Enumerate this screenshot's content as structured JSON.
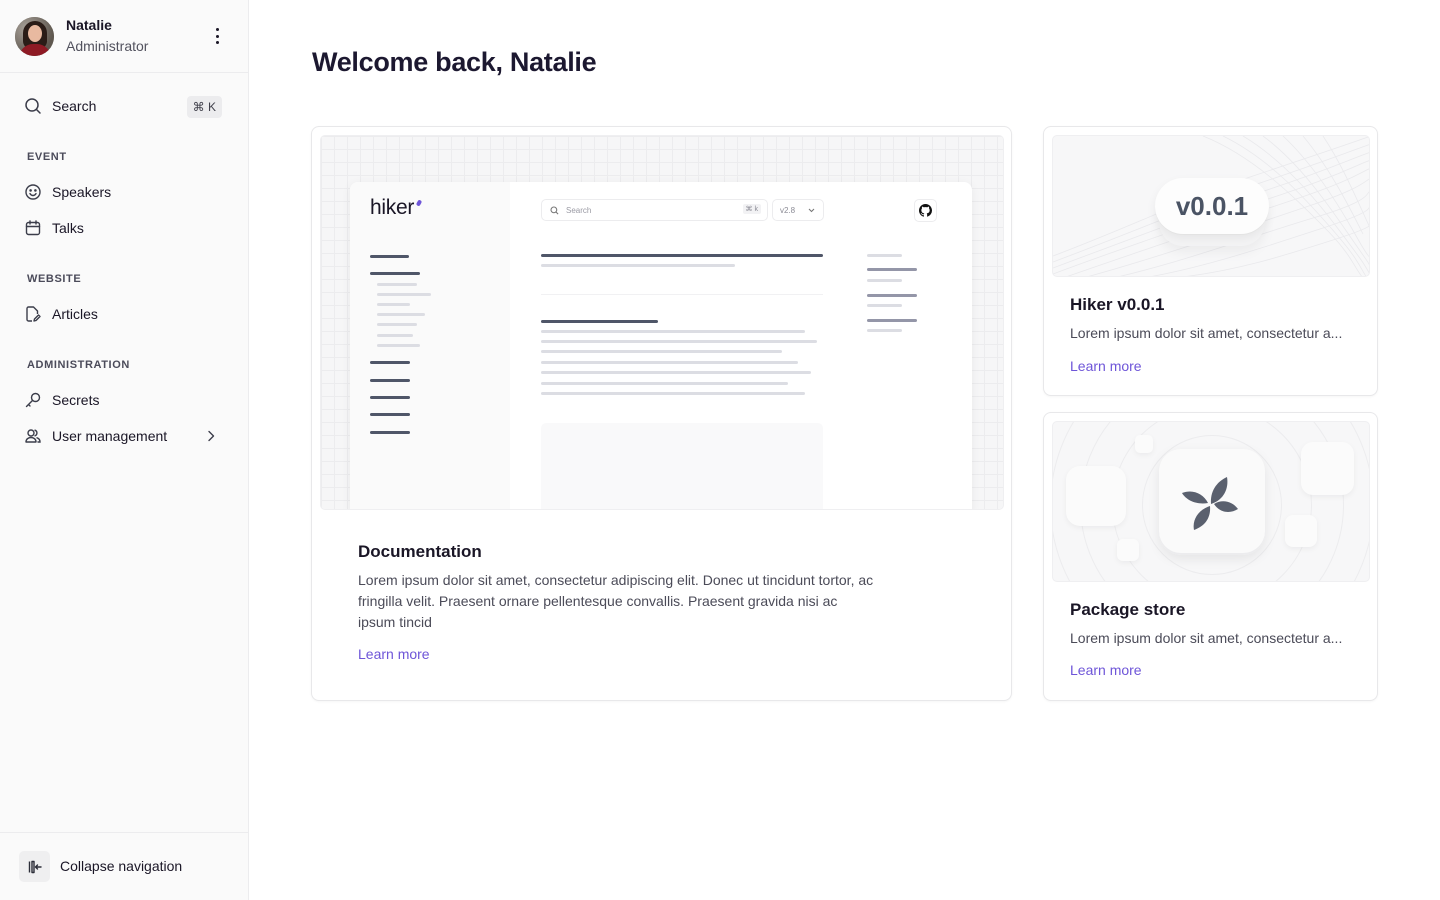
{
  "profile": {
    "name": "Natalie",
    "role": "Administrator"
  },
  "sidebar": {
    "search": {
      "label": "Search",
      "shortcut": "⌘ K",
      "icon": "search-icon"
    },
    "sections": [
      {
        "label": "EVENT",
        "items": [
          {
            "label": "Speakers",
            "icon": "smiley-icon"
          },
          {
            "label": "Talks",
            "icon": "calendar-icon"
          }
        ]
      },
      {
        "label": "WEBSITE",
        "items": [
          {
            "label": "Articles",
            "icon": "document-edit-icon"
          }
        ]
      },
      {
        "label": "ADMINISTRATION",
        "items": [
          {
            "label": "Secrets",
            "icon": "key-icon"
          },
          {
            "label": "User management",
            "icon": "users-icon",
            "has_submenu": true
          }
        ]
      }
    ],
    "collapse_label": "Collapse navigation"
  },
  "main": {
    "title": "Welcome back, Natalie",
    "cards": [
      {
        "id": "documentation",
        "title": "Documentation",
        "description": "Lorem ipsum dolor sit amet, consectetur adipiscing elit. Donec ut tincidunt tortor, ac fringilla velit. Praesent ornare pellentesque convallis. Praesent gravida nisi ac ipsum tincid",
        "link": "Learn more",
        "preview": {
          "logo": "hiker",
          "search_placeholder": "Search",
          "search_shortcut": "⌘ k",
          "version": "v2.8"
        }
      },
      {
        "id": "release",
        "title": "Hiker v0.0.1",
        "description": "Lorem ipsum dolor sit amet, consectetur a...",
        "link": "Learn more",
        "badge": "v0.0.1"
      },
      {
        "id": "package-store",
        "title": "Package store",
        "description": "Lorem ipsum dolor sit amet, consectetur a...",
        "link": "Learn more"
      }
    ]
  },
  "colors": {
    "accent": "#6e55d8",
    "text": "#1a1626",
    "muted": "#4b4b58",
    "sidebar_bg": "#fafafa",
    "border": "#e8e8ea"
  }
}
